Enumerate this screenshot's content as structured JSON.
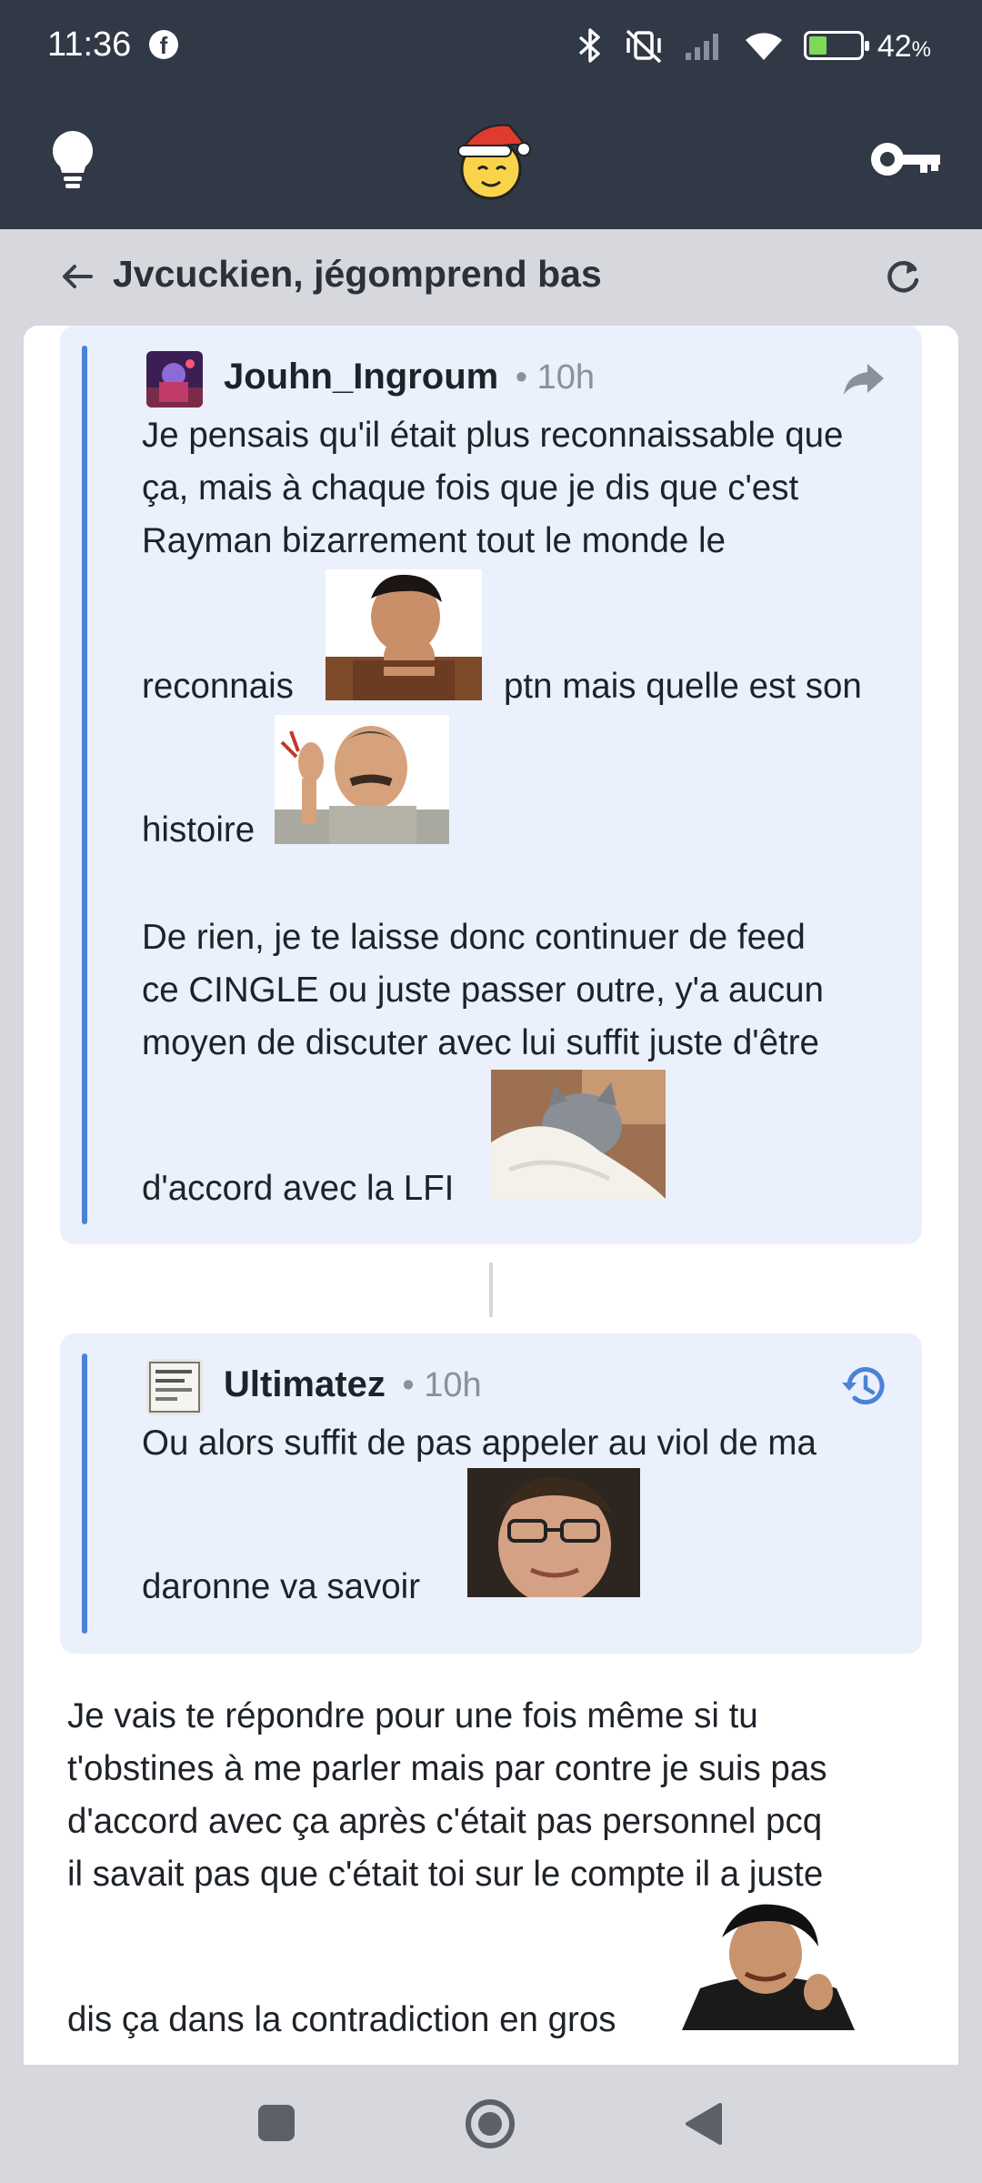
{
  "status_bar": {
    "time": "11:36",
    "notification_icon": "facebook-icon",
    "icons": [
      "bluetooth-icon",
      "vibrate-off-icon",
      "signal-icon",
      "wifi-icon",
      "battery-charging-icon"
    ],
    "battery_percent": "42",
    "battery_unit": "%",
    "battery_level": 0.42
  },
  "app_bar": {
    "left_icon": "lightbulb-icon",
    "center_icon": "santa-hat-smiley-logo",
    "right_icon": "key-icon"
  },
  "topic": {
    "title": "Jvcuckien, jégomprend bas",
    "back_icon": "arrow-back-icon",
    "refresh_icon": "refresh-icon"
  },
  "posts": [
    {
      "author": "Jouhn_Ingroum",
      "separator": "•",
      "age": "10h",
      "action_icon": "share-arrow-icon",
      "lines": [
        "Je pensais qu'il était plus reconnaissable que",
        "ça, mais à chaque fois que je dis que c'est",
        "Rayman bizarrement tout le monde le",
        "reconnais",
        "ptn mais quelle est son",
        "histoire",
        "De rien, je te laisse donc continuer de feed",
        "ce CINGLE ou juste passer outre, y'a aucun",
        "moyen de discuter avec lui suffit juste d'être",
        "d'accord avec la LFI"
      ]
    },
    {
      "author": "Ultimatez",
      "separator": "•",
      "age": "10h",
      "action_icon": "history-icon",
      "lines": [
        "Ou alors suffit de pas appeler au viol de ma",
        "daronne va savoir"
      ]
    }
  ],
  "reply": {
    "lines": [
      "Je vais te répondre pour une fois même si tu",
      "t'obstines à me parler mais par contre je suis pas",
      "d'accord avec ça après c'était pas personnel pcq",
      "il savait pas que c'était toi sur le compte il a juste",
      "dis ça dans la contradiction en gros"
    ]
  },
  "nav_bar": {
    "recents_icon": "square-icon",
    "home_icon": "circle-home-icon",
    "back_icon": "triangle-back-icon"
  }
}
